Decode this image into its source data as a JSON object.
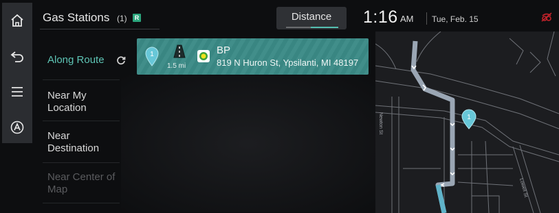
{
  "header": {
    "title": "Gas Stations",
    "count": "(1)",
    "badge": "R",
    "sort_label": "Distance",
    "time": "1:16",
    "ampm": "AM",
    "date": "Tue, Feb. 15"
  },
  "rail": {
    "icons": [
      "home-icon",
      "back-icon",
      "menu-icon",
      "navigation-icon"
    ]
  },
  "menu": {
    "items": [
      {
        "label": "Along Route",
        "state": "active"
      },
      {
        "label": "Near My Location",
        "state": "normal"
      },
      {
        "label": "Near Destination",
        "state": "normal"
      },
      {
        "label": "Near Center of Map",
        "state": "disabled"
      }
    ]
  },
  "result": {
    "index": "1",
    "distance": "1.5 mi",
    "name": "BP",
    "address": "819 N Huron St, Ypsilanti, MI 48197"
  },
  "map": {
    "streets": [
      "Newton St",
      "Lowell St"
    ],
    "marker": "1"
  },
  "colors": {
    "accent": "#5ec4b5",
    "card": "#3b8a86",
    "route": "#9aa6b4"
  }
}
